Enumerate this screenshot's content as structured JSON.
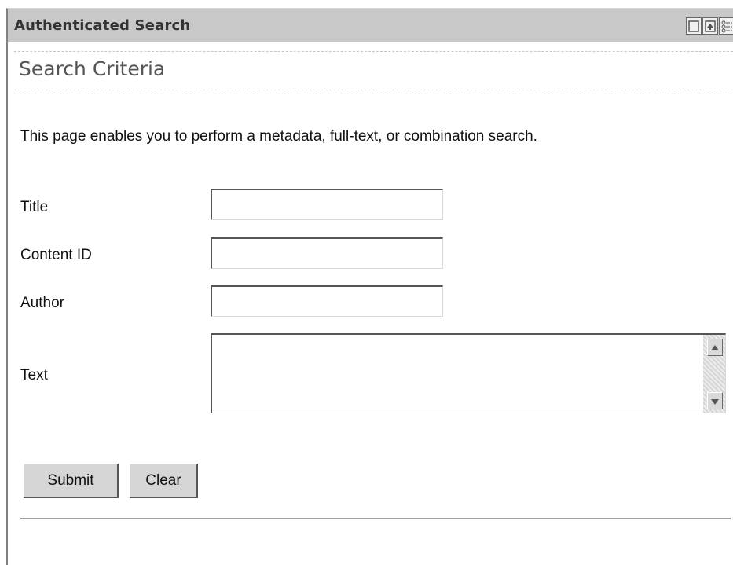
{
  "portlet": {
    "title": "Authenticated Search",
    "controls": {
      "minimize_icon": "minimize-icon",
      "maximize_icon": "maximize-icon",
      "menu_icon": "options-menu-icon"
    }
  },
  "section": {
    "heading": "Search Criteria"
  },
  "intro_text": "This page enables you to perform a metadata, full-text, or combination search.",
  "form": {
    "title_label": "Title",
    "title_value": "",
    "content_id_label": "Content ID",
    "content_id_value": "",
    "author_label": "Author",
    "author_value": "",
    "text_label": "Text",
    "text_value": ""
  },
  "buttons": {
    "submit_label": "Submit",
    "clear_label": "Clear"
  }
}
